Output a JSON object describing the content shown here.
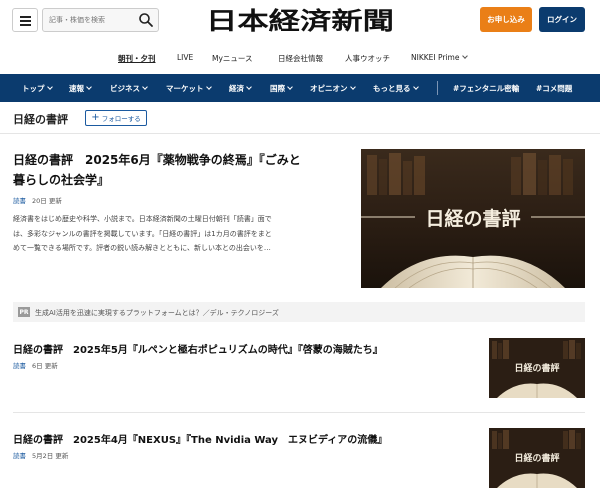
{
  "header": {
    "search_placeholder": "記事・株価を検索",
    "logo_text": "日本経済新聞",
    "apply_label": "お申し込み",
    "login_label": "ログイン"
  },
  "subnav": {
    "items": [
      "朝刊・夕刊",
      "LIVE",
      "Myニュース",
      "日経会社情報",
      "人事ウオッチ",
      "NIKKEI Prime"
    ]
  },
  "mainnav": {
    "items": [
      "トップ",
      "速報",
      "ビジネス",
      "マーケット",
      "経済",
      "国際",
      "オピニオン",
      "もっと見る",
      "#フェンタニル密輸",
      "#コメ問題"
    ]
  },
  "section": {
    "title": "日経の書評",
    "follow_label": "フォローする"
  },
  "featured": {
    "title_line1": "日経の書評　2025年6月『薬物戦争の終焉』『ごみと",
    "title_line2": "暮らしの社会学』",
    "tag": "読書",
    "date": "20日 更新",
    "desc_line1": "経済書をはじめ歴史や科学、小説まで。日本経済新聞の土曜日付朝刊「読書」面で",
    "desc_line2": "は、多彩なジャンルの書評を掲載しています。「日経の書評」は1カ月の書評をまと",
    "desc_line3": "めて一覧できる場所です。評者の鋭い読み解きとともに、新しい本との出会いを…",
    "image_caption": "日経の書評"
  },
  "pr": {
    "label": "PR",
    "text": "生成AI活用を迅速に実現するプラットフォームとは？／デル・テクノロジーズ"
  },
  "articles": [
    {
      "title": "日経の書評　2025年5月『ルペンと極右ポピュリズムの時代』『啓蒙の海賊たち』",
      "tag": "読書",
      "date": "6日 更新",
      "image_caption": "日経の書評"
    },
    {
      "title": "日経の書評　2025年4月『NEXUS』『The Nvidia Way　エヌビディアの流儀』",
      "tag": "読書",
      "date": "5月2日 更新",
      "image_caption": "日経の書評"
    }
  ],
  "colors": {
    "brand_navy": "#0b3b6e",
    "apply_orange": "#ea7f17",
    "link_blue": "#1b5aa0"
  }
}
